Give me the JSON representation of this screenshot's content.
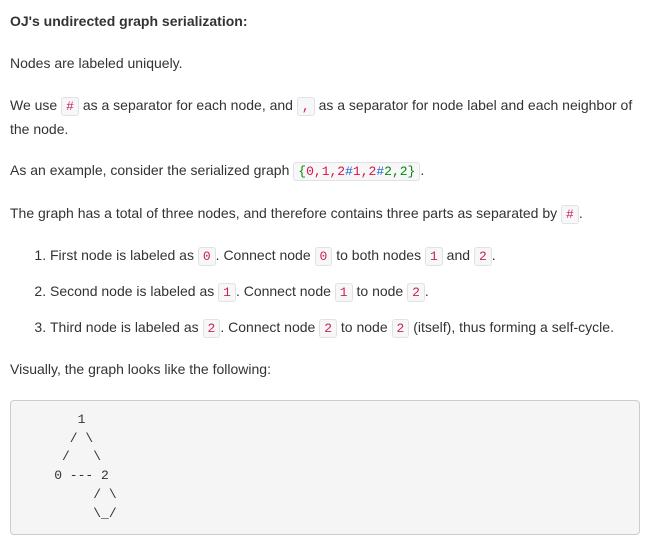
{
  "heading": "OJ's undirected graph serialization:",
  "p_intro": "Nodes are labeled uniquely.",
  "p_sep_1": "We use ",
  "tok_hash": "#",
  "p_sep_2": " as a separator for each node, and ",
  "tok_comma": ",",
  "p_sep_3": " as a separator for node label and each neighbor of the node.",
  "p_ex_1": "As an example, consider the serialized graph ",
  "ex_code": {
    "lbrace": "{",
    "s1": "0,1,2",
    "h1": "#",
    "s2": "1,2",
    "h2": "#",
    "s3": "2,2",
    "rbrace": "}"
  },
  "p_ex_2": ".",
  "p_three_1": "The graph has a total of three nodes, and therefore contains three parts as separated by ",
  "p_three_code": "#",
  "p_three_2": ".",
  "items": [
    {
      "a": "First node is labeled as ",
      "c1": "0",
      "b": ". Connect node ",
      "c2": "0",
      "c": " to both nodes ",
      "c3": "1",
      "d": " and ",
      "c4": "2",
      "e": "."
    },
    {
      "a": "Second node is labeled as ",
      "c1": "1",
      "b": ". Connect node ",
      "c2": "1",
      "c": " to node ",
      "c3": "2",
      "d": "",
      "c4": "",
      "e": "."
    },
    {
      "a": "Third node is labeled as ",
      "c1": "2",
      "b": ". Connect node ",
      "c2": "2",
      "c": " to node ",
      "c3": "2",
      "d": " (itself), thus forming a self-cycle.",
      "c4": "",
      "e": ""
    }
  ],
  "p_visual": "Visually, the graph looks like the following:",
  "ascii": "       1\n      / \\\n     /   \\\n    0 --- 2\n         / \\\n         \\_/"
}
